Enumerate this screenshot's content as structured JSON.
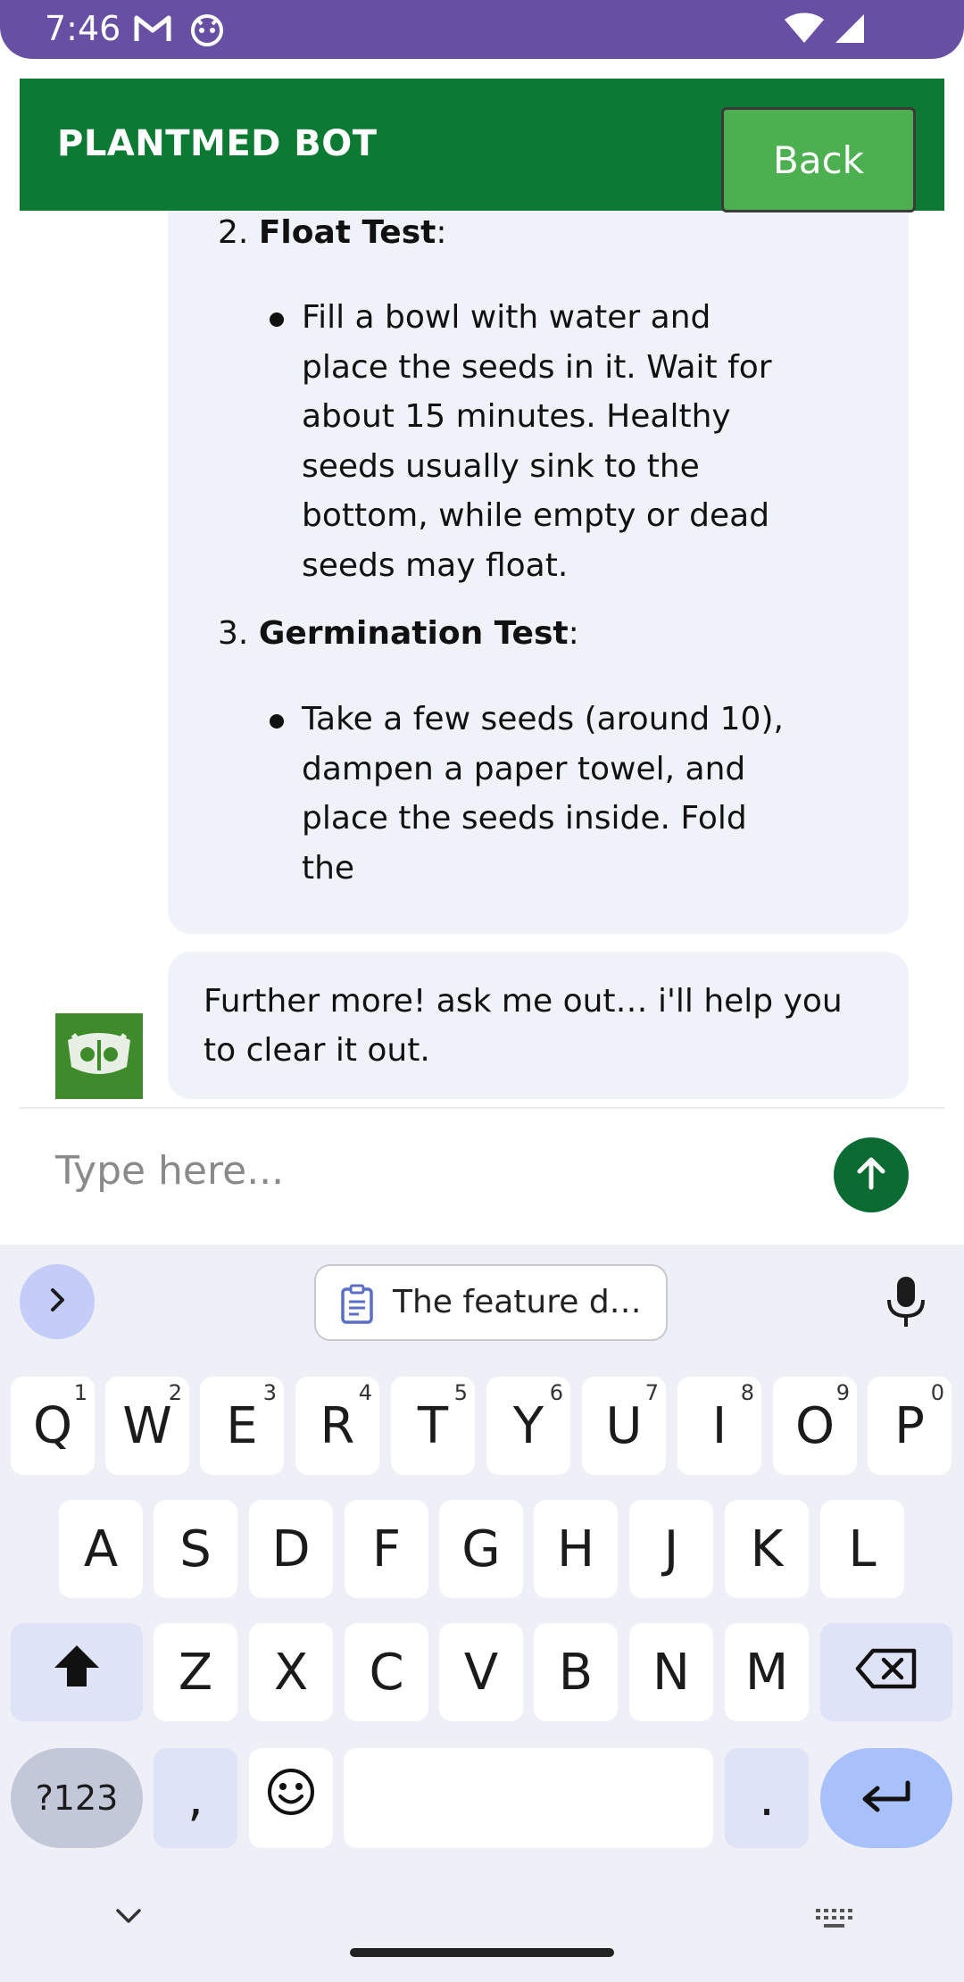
{
  "status_bar": {
    "time": "7:46"
  },
  "app_bar": {
    "title": "PLANTMED BOT",
    "back_label": "Back"
  },
  "chat": {
    "message1": {
      "item2": {
        "number": "2.",
        "title": "Float Test",
        "suffix": ":"
      },
      "item2_bullet": "Fill a bowl with water and place the seeds in it. Wait for about 15 minutes. Healthy seeds usually sink to the bottom, while empty or dead seeds may float.",
      "item3": {
        "number": "3.",
        "title": "Germination Test",
        "suffix": ":"
      },
      "item3_bullet": "Take a few seeds (around 10), dampen a paper towel, and place the seeds inside. Fold the"
    },
    "message2": "Further more! ask me out… i'll help you to clear it out."
  },
  "input": {
    "placeholder": "Type here..."
  },
  "keyboard": {
    "clipboard_suggestion": "The feature d…",
    "row1": [
      {
        "k": "Q",
        "s": "1"
      },
      {
        "k": "W",
        "s": "2"
      },
      {
        "k": "E",
        "s": "3"
      },
      {
        "k": "R",
        "s": "4"
      },
      {
        "k": "T",
        "s": "5"
      },
      {
        "k": "Y",
        "s": "6"
      },
      {
        "k": "U",
        "s": "7"
      },
      {
        "k": "I",
        "s": "8"
      },
      {
        "k": "O",
        "s": "9"
      },
      {
        "k": "P",
        "s": "0"
      }
    ],
    "row2": [
      "A",
      "S",
      "D",
      "F",
      "G",
      "H",
      "J",
      "K",
      "L"
    ],
    "row3": [
      "Z",
      "X",
      "C",
      "V",
      "B",
      "N",
      "M"
    ],
    "symbols_label": "?123",
    "comma": ",",
    "period": "."
  },
  "colors": {
    "app_bar": "#0c7a33",
    "back_button": "#4caf50",
    "status_bar": "#6750a4",
    "bubble": "#eff2f8",
    "send": "#0c6b32"
  }
}
